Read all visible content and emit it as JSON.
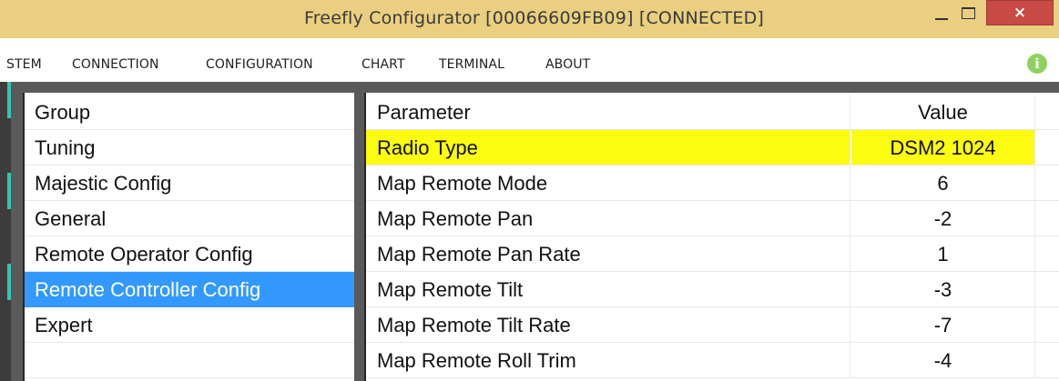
{
  "window": {
    "title": "Freefly Configurator [00066609FB09] [CONNECTED]",
    "minimize_label": "–",
    "close_label": "×"
  },
  "menu": {
    "items": [
      "STEM",
      "CONNECTION",
      "CONFIGURATION",
      "CHART",
      "TERMINAL",
      "ABOUT"
    ],
    "info_icon": "info-icon",
    "info_color": "#8ed15f"
  },
  "groups": {
    "header": "Group",
    "items": [
      "Tuning",
      "Majestic Config",
      "General",
      "Remote Operator Config",
      "Remote Controller Config",
      "Expert"
    ],
    "selected": "Remote Controller Config",
    "selected_color": "#3399ff"
  },
  "params": {
    "header_name": "Parameter",
    "header_value": "Value",
    "highlight_color": "#fcfc11",
    "rows": [
      {
        "name": "Radio Type",
        "value": "DSM2 1024"
      },
      {
        "name": "Map Remote Mode",
        "value": "6"
      },
      {
        "name": "Map Remote Pan",
        "value": "-2"
      },
      {
        "name": "Map Remote Pan Rate",
        "value": "1"
      },
      {
        "name": "Map Remote Tilt",
        "value": "-3"
      },
      {
        "name": "Map Remote Tilt Rate",
        "value": "-7"
      },
      {
        "name": "Map Remote Roll Trim",
        "value": "-4"
      }
    ]
  }
}
